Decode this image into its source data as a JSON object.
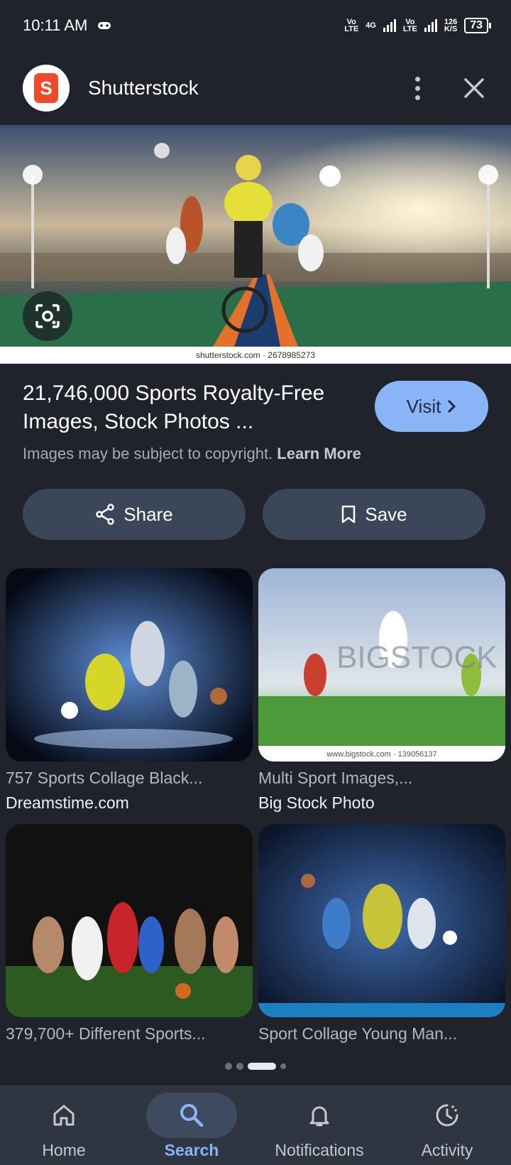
{
  "status": {
    "time": "10:11 AM",
    "net1_top": "Vo",
    "net1_bottom": "LTE",
    "net2_top": "4G",
    "net3_top": "Vo",
    "net3_bottom": "LTE",
    "speed_top": "126",
    "speed_bottom": "K/S",
    "battery": "73"
  },
  "header": {
    "site_name": "Shutterstock",
    "logo_letter": "S"
  },
  "hero": {
    "caption": "shutterstock.com · 2678985273"
  },
  "result": {
    "title": "21,746,000 Sports Royalty-Free Images, Stock Photos ...",
    "visit_label": "Visit",
    "copyright_text": "Images may be subject to copyright.",
    "learn_more": "Learn More"
  },
  "actions": {
    "share_label": "Share",
    "save_label": "Save"
  },
  "related": [
    {
      "title": "757 Sports Collage Black...",
      "source": "Dreamstime.com"
    },
    {
      "title": "Multi Sport Images,...",
      "source": "Big Stock Photo",
      "watermark": "BIGSTOCK",
      "caption": "www.bigstock.com · 139056137"
    },
    {
      "title": "379,700+ Different Sports...",
      "source": ""
    },
    {
      "title": "Sport Collage Young Man...",
      "source": ""
    }
  ],
  "nav": {
    "home": "Home",
    "search": "Search",
    "notifications": "Notifications",
    "activity": "Activity"
  },
  "colors": {
    "background": "#20232b",
    "accent": "#8ab4f8",
    "button": "#3b4658",
    "logo_orange": "#ee4b2b"
  }
}
